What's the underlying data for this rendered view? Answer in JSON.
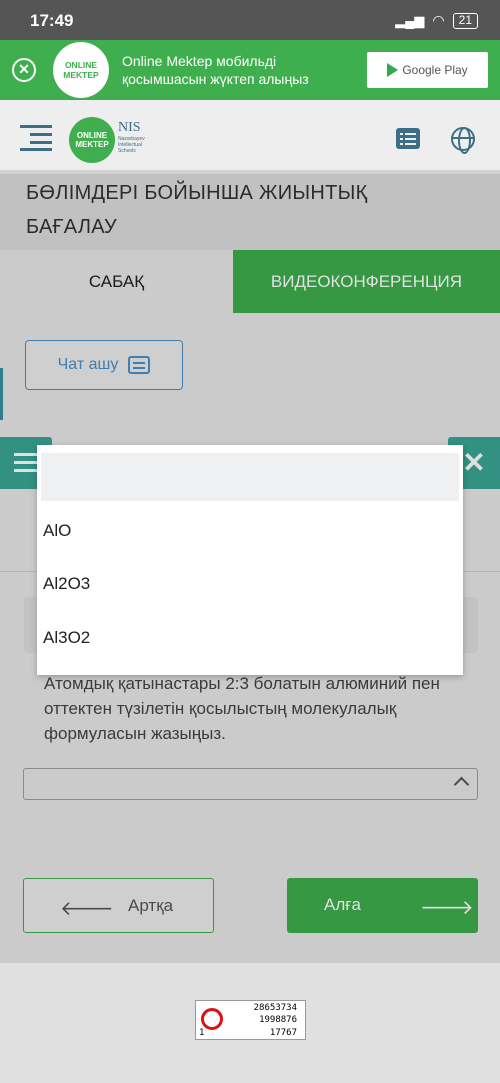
{
  "status_bar": {
    "time": "17:49",
    "battery": "21"
  },
  "banner": {
    "logo_line1": "ONLINE",
    "logo_line2": "MEKTEP",
    "text_line1": "Online Mektep мобильді",
    "text_line2": "қосымшасын жүктеп алыңыз",
    "store_label": "Google Play"
  },
  "header": {
    "logo_line1": "ONLINE",
    "logo_line2": "MEKTEP",
    "nis_name": "NIS",
    "nis_sub1": "Nazarbayev",
    "nis_sub2": "Intellectual",
    "nis_sub3": "Schools"
  },
  "page_title": {
    "line1": "БӨЛІМДЕРІ БОЙЫНША ЖИЫНТЫҚ",
    "line2": "БАҒАЛАУ"
  },
  "tabs": {
    "lesson": "САБАҚ",
    "video": "ВИДЕОКОНФЕРЕНЦИЯ"
  },
  "chat_button": {
    "label": "Чат ашу"
  },
  "question": {
    "text": "Атомдық қатынастары 2:3 болатын алюминий пен оттектен түзілетін қосылыстың молекулалық формуласын жазыңыз."
  },
  "dropdown": {
    "search_value": "",
    "options": [
      "AlO",
      "Al2O3",
      "Al3O2"
    ]
  },
  "nav": {
    "back_label": "Артқа",
    "next_label": "Алға"
  },
  "counter": {
    "row1": "28653734",
    "row2": "1998876",
    "row3": "17767",
    "row3_left": "1"
  },
  "colors": {
    "brand_green": "#3fae4e",
    "brand_blue": "#3c6e86",
    "teal": "#3aa594",
    "link_blue": "#4a8fc7"
  }
}
